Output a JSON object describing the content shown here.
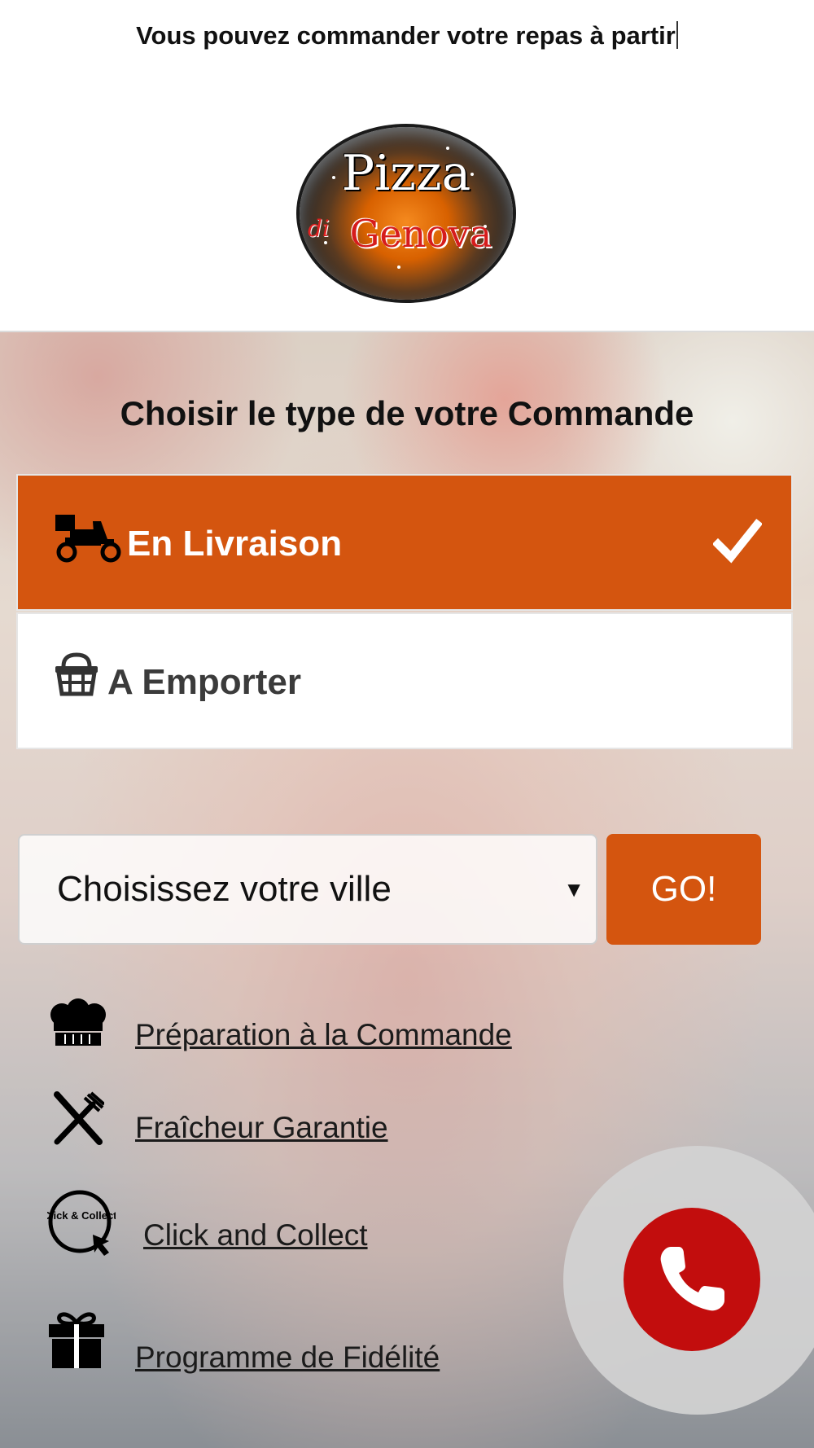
{
  "header": {
    "tagline": "Vous pouvez commander votre repas à partir",
    "logo": {
      "line1": "Pizza",
      "line2": "di",
      "line3": "Genova"
    }
  },
  "order_type": {
    "title": "Choisir le type de votre Commande",
    "options": [
      {
        "label": "En Livraison",
        "icon": "scooter-icon",
        "selected": true
      },
      {
        "label": "A Emporter",
        "icon": "basket-icon",
        "selected": false
      }
    ]
  },
  "city": {
    "selected": "Choisissez votre ville",
    "go_label": "GO!"
  },
  "features": [
    {
      "label": "Préparation à la Commande",
      "icon": "chef-hat-icon"
    },
    {
      "label": "Fraîcheur Garantie",
      "icon": "fork-knife-icon"
    },
    {
      "label": "Click and Collect",
      "icon": "click-collect-icon",
      "icon_text": "Click & Collect"
    },
    {
      "label": "Programme de Fidélité",
      "icon": "gift-icon"
    }
  ],
  "call": {
    "icon": "phone-icon"
  },
  "colors": {
    "accent": "#d4550f",
    "call_red": "#c20d0d",
    "text": "#111111"
  }
}
